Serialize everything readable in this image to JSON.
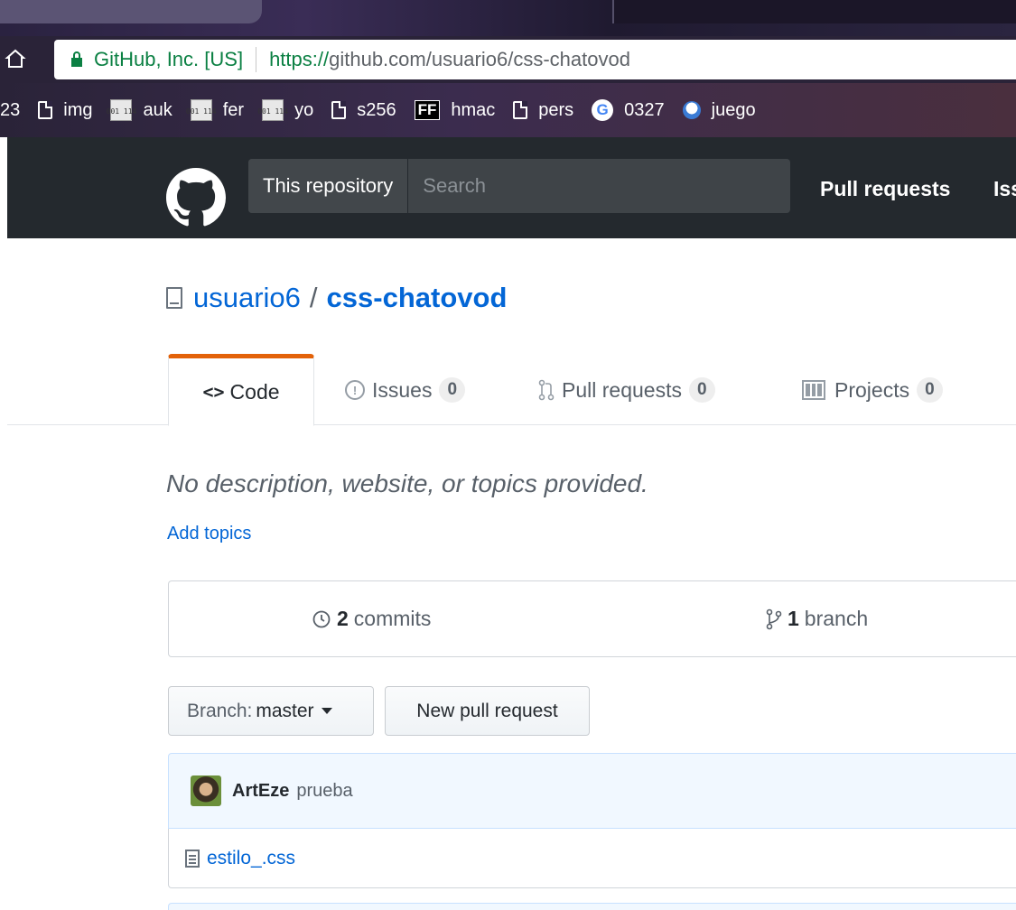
{
  "browser": {
    "site_identity": "GitHub, Inc. [US]",
    "url_scheme": "https://",
    "url_rest": "github.com/usuario6/css-chatovod",
    "bookmarks": [
      {
        "label": "23",
        "icon": "none"
      },
      {
        "label": "img",
        "icon": "doc-icon"
      },
      {
        "label": "auk",
        "icon": "numbered-icon"
      },
      {
        "label": "fer",
        "icon": "numbered-icon"
      },
      {
        "label": "yo",
        "icon": "numbered-icon"
      },
      {
        "label": "s256",
        "icon": "doc-icon"
      },
      {
        "label": "hmac",
        "icon": "ff-icon"
      },
      {
        "label": "pers",
        "icon": "doc-icon"
      },
      {
        "label": "0327",
        "icon": "google-icon"
      },
      {
        "label": "juego",
        "icon": "circle-icon"
      }
    ],
    "numbered_icon_text": "001 114",
    "ff_icon_text": "FF",
    "google_icon_text": "G"
  },
  "header": {
    "search_scope": "This repository",
    "search_placeholder": "Search",
    "nav_pulls": "Pull requests",
    "nav_issues": "Issues"
  },
  "repo": {
    "owner": "usuario6",
    "slash": "/",
    "name": "css-chatovod",
    "description": "No description, website, or topics provided.",
    "add_topics": "Add topics"
  },
  "tabs": {
    "code": {
      "icon": "<>",
      "label": "Code"
    },
    "issues": {
      "label": "Issues",
      "count": "0"
    },
    "pulls": {
      "label": "Pull requests",
      "count": "0"
    },
    "projects": {
      "label": "Projects",
      "count": "0"
    }
  },
  "summary": {
    "commits_count": "2",
    "commits_label": "commits",
    "branches_count": "1",
    "branches_label": "branch"
  },
  "actions": {
    "branch_prefix": "Branch:",
    "branch_name": "master",
    "new_pr": "New pull request"
  },
  "commit": {
    "author": "ArtEze",
    "message": "prueba"
  },
  "files": [
    {
      "name": "estilo_.css"
    }
  ],
  "colors": {
    "header_bg": "#24292e",
    "link": "#0366d6",
    "tab_accent": "#e36209",
    "commit_bg": "#f1f8ff"
  }
}
